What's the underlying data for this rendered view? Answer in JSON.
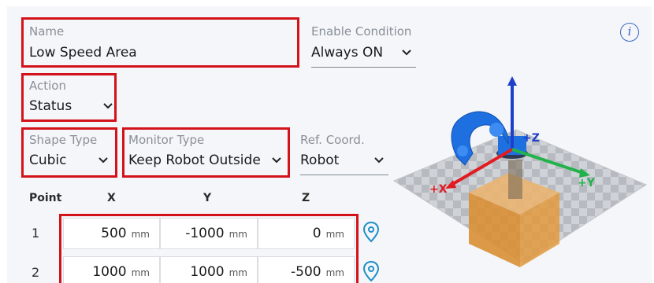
{
  "name": {
    "label": "Name",
    "value": "Low Speed Area"
  },
  "enable_condition": {
    "label": "Enable Condition",
    "value": "Always ON"
  },
  "action": {
    "label": "Action",
    "value": "Status"
  },
  "shape_type": {
    "label": "Shape Type",
    "value": "Cubic"
  },
  "monitor_type": {
    "label": "Monitor Type",
    "value": "Keep Robot Outside"
  },
  "ref_coord": {
    "label": "Ref. Coord.",
    "value": "Robot"
  },
  "info_icon": {
    "glyph": "i",
    "icon": "info-icon"
  },
  "table": {
    "headers": {
      "point": "Point",
      "x": "X",
      "y": "Y",
      "z": "Z"
    },
    "unit": "mm",
    "rows": [
      {
        "point": "1",
        "x": "500",
        "y": "-1000",
        "z": "0"
      },
      {
        "point": "2",
        "x": "1000",
        "y": "1000",
        "z": "-500"
      }
    ]
  },
  "scene": {
    "axes": {
      "x": "+X",
      "y": "+Y",
      "z": "+Z"
    },
    "colors": {
      "x": "#e11b22",
      "y": "#22b24c",
      "z": "#1d3fc9",
      "robot": "#1e6fe0",
      "box": "#e39a3e",
      "highlight": "#d3121a"
    }
  }
}
